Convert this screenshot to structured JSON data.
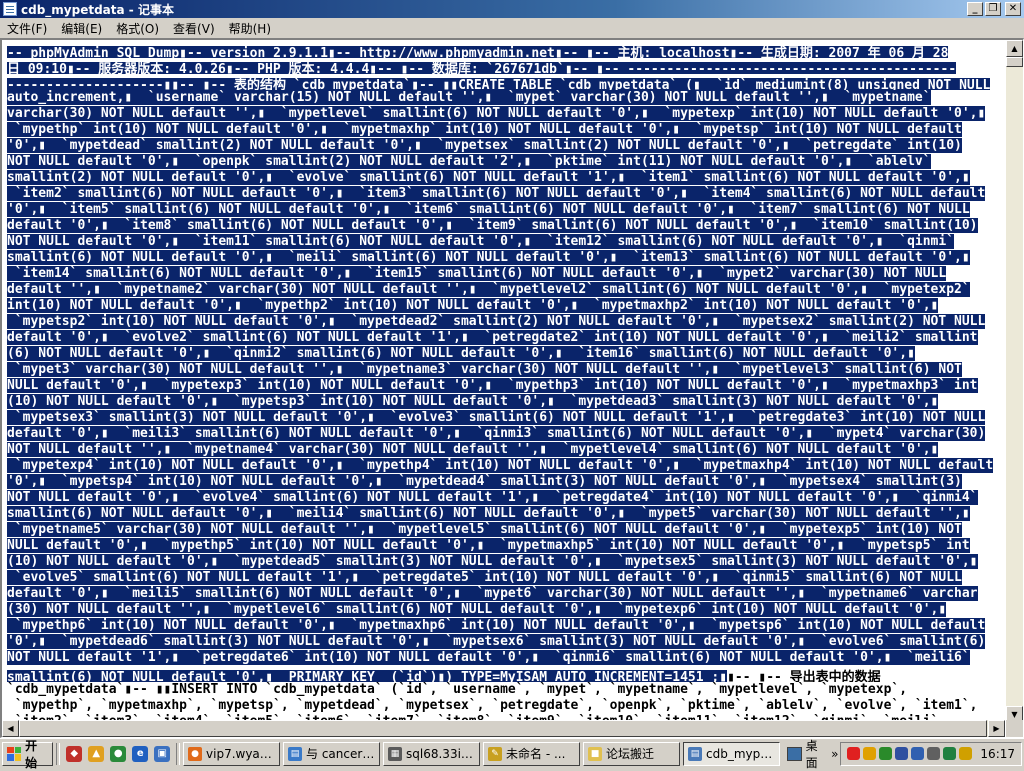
{
  "window": {
    "title": "cdb_mypetdata - 记事本",
    "minimize_glyph": "_",
    "maximize_glyph": "❐",
    "close_glyph": "✕"
  },
  "menu": [
    "文件(F)",
    "编辑(E)",
    "格式(O)",
    "查看(V)",
    "帮助(H)"
  ],
  "editor": {
    "lines": [
      {
        "sel": "-- phpMyAdmin SQL Dump▮-- version 2.9.1.1▮-- http://www.phpmyadmin.net▮-- ▮-- 主机: localhost▮-- 生成日期: 2007 年 06 月 28",
        "rest": ""
      },
      {
        "sel": "日 09:10▮-- 服务器版本: 4.0.26▮-- PHP 版本: 4.4.4▮-- ▮-- 数据库: `267671db`▮-- ▮-- ------------------------------------------",
        "rest": ""
      },
      {
        "sel": "--------------------▮▮-- ▮-- 表的结构 `cdb_mypetdata`▮-- ▮▮CREATE TABLE `cdb_mypetdata` (▮  `id` mediumint(8) unsigned NOT NULL",
        "rest": ""
      },
      {
        "sel": "auto_increment,▮  `username` varchar(15) NOT NULL default '',▮  `mypet` varchar(30) NOT NULL default '',▮  `mypetname`",
        "rest": ""
      },
      {
        "sel": "varchar(30) NOT NULL default '',▮  `mypetlevel` smallint(6) NOT NULL default '0',▮  `mypetexp` int(10) NOT NULL default '0',▮",
        "rest": ""
      },
      {
        "sel": " `mypethp` int(10) NOT NULL default '0',▮  `mypetmaxhp` int(10) NOT NULL default '0',▮  `mypetsp` int(10) NOT NULL default",
        "rest": ""
      },
      {
        "sel": "'0',▮  `mypetdead` smallint(2) NOT NULL default '0',▮  `mypetsex` smallint(2) NOT NULL default '0',▮  `petregdate` int(10)",
        "rest": ""
      },
      {
        "sel": "NOT NULL default '0',▮  `openpk` smallint(2) NOT NULL default '2',▮  `pktime` int(11) NOT NULL default '0',▮  `ablelv`",
        "rest": ""
      },
      {
        "sel": "smallint(2) NOT NULL default '0',▮  `evolve` smallint(6) NOT NULL default '1',▮  `item1` smallint(6) NOT NULL default '0',▮",
        "rest": ""
      },
      {
        "sel": " `item2` smallint(6) NOT NULL default '0',▮  `item3` smallint(6) NOT NULL default '0',▮  `item4` smallint(6) NOT NULL default",
        "rest": ""
      },
      {
        "sel": "'0',▮  `item5` smallint(6) NOT NULL default '0',▮  `item6` smallint(6) NOT NULL default '0',▮  `item7` smallint(6) NOT NULL",
        "rest": ""
      },
      {
        "sel": "default '0',▮  `item8` smallint(6) NOT NULL default '0',▮  `item9` smallint(6) NOT NULL default '0',▮  `item10` smallint(10)",
        "rest": ""
      },
      {
        "sel": "NOT NULL default '0',▮  `item11` smallint(6) NOT NULL default '0',▮  `item12` smallint(6) NOT NULL default '0',▮  `qinmi`",
        "rest": ""
      },
      {
        "sel": "smallint(6) NOT NULL default '0',▮  `meili` smallint(6) NOT NULL default '0',▮  `item13` smallint(6) NOT NULL default '0',▮",
        "rest": ""
      },
      {
        "sel": " `item14` smallint(6) NOT NULL default '0',▮  `item15` smallint(6) NOT NULL default '0',▮  `mypet2` varchar(30) NOT NULL",
        "rest": ""
      },
      {
        "sel": "default '',▮  `mypetname2` varchar(30) NOT NULL default '',▮  `mypetlevel2` smallint(6) NOT NULL default '0',▮  `mypetexp2`",
        "rest": ""
      },
      {
        "sel": "int(10) NOT NULL default '0',▮  `mypethp2` int(10) NOT NULL default '0',▮  `mypetmaxhp2` int(10) NOT NULL default '0',▮",
        "rest": ""
      },
      {
        "sel": " `mypetsp2` int(10) NOT NULL default '0',▮  `mypetdead2` smallint(2) NOT NULL default '0',▮  `mypetsex2` smallint(2) NOT NULL",
        "rest": ""
      },
      {
        "sel": "default '0',▮  `evolve2` smallint(6) NOT NULL default '1',▮  `petregdate2` int(10) NOT NULL default '0',▮  `meili2` smallint",
        "rest": ""
      },
      {
        "sel": "(6) NOT NULL default '0',▮  `qinmi2` smallint(6) NOT NULL default '0',▮  `item16` smallint(6) NOT NULL default '0',▮",
        "rest": ""
      },
      {
        "sel": " `mypet3` varchar(30) NOT NULL default '',▮  `mypetname3` varchar(30) NOT NULL default '',▮  `mypetlevel3` smallint(6) NOT",
        "rest": ""
      },
      {
        "sel": "NULL default '0',▮  `mypetexp3` int(10) NOT NULL default '0',▮  `mypethp3` int(10) NOT NULL default '0',▮  `mypetmaxhp3` int",
        "rest": ""
      },
      {
        "sel": "(10) NOT NULL default '0',▮  `mypetsp3` int(10) NOT NULL default '0',▮  `mypetdead3` smallint(3) NOT NULL default '0',▮",
        "rest": ""
      },
      {
        "sel": " `mypetsex3` smallint(3) NOT NULL default '0',▮  `evolve3` smallint(6) NOT NULL default '1',▮  `petregdate3` int(10) NOT NULL",
        "rest": ""
      },
      {
        "sel": "default '0',▮  `meili3` smallint(6) NOT NULL default '0',▮  `qinmi3` smallint(6) NOT NULL default '0',▮  `mypet4` varchar(30)",
        "rest": ""
      },
      {
        "sel": "NOT NULL default '',▮  `mypetname4` varchar(30) NOT NULL default '',▮  `mypetlevel4` smallint(6) NOT NULL default '0',▮",
        "rest": ""
      },
      {
        "sel": " `mypetexp4` int(10) NOT NULL default '0',▮  `mypethp4` int(10) NOT NULL default '0',▮  `mypetmaxhp4` int(10) NOT NULL default",
        "rest": ""
      },
      {
        "sel": "'0',▮  `mypetsp4` int(10) NOT NULL default '0',▮  `mypetdead4` smallint(3) NOT NULL default '0',▮  `mypetsex4` smallint(3)",
        "rest": ""
      },
      {
        "sel": "NOT NULL default '0',▮  `evolve4` smallint(6) NOT NULL default '1',▮  `petregdate4` int(10) NOT NULL default '0',▮  `qinmi4`",
        "rest": ""
      },
      {
        "sel": "smallint(6) NOT NULL default '0',▮  `meili4` smallint(6) NOT NULL default '0',▮  `mypet5` varchar(30) NOT NULL default '',▮",
        "rest": ""
      },
      {
        "sel": " `mypetname5` varchar(30) NOT NULL default '',▮  `mypetlevel5` smallint(6) NOT NULL default '0',▮  `mypetexp5` int(10) NOT",
        "rest": ""
      },
      {
        "sel": "NULL default '0',▮  `mypethp5` int(10) NOT NULL default '0',▮  `mypetmaxhp5` int(10) NOT NULL default '0',▮  `mypetsp5` int",
        "rest": ""
      },
      {
        "sel": "(10) NOT NULL default '0',▮  `mypetdead5` smallint(3) NOT NULL default '0',▮  `mypetsex5` smallint(3) NOT NULL default '0',▮",
        "rest": ""
      },
      {
        "sel": " `evolve5` smallint(6) NOT NULL default '1',▮  `petregdate5` int(10) NOT NULL default '0',▮  `qinmi5` smallint(6) NOT NULL",
        "rest": ""
      },
      {
        "sel": "default '0',▮  `meili5` smallint(6) NOT NULL default '0',▮  `mypet6` varchar(30) NOT NULL default '',▮  `mypetname6` varchar",
        "rest": ""
      },
      {
        "sel": "(30) NOT NULL default '',▮  `mypetlevel6` smallint(6) NOT NULL default '0',▮  `mypetexp6` int(10) NOT NULL default '0',▮",
        "rest": ""
      },
      {
        "sel": " `mypethp6` int(10) NOT NULL default '0',▮  `mypetmaxhp6` int(10) NOT NULL default '0',▮  `mypetsp6` int(10) NOT NULL default",
        "rest": ""
      },
      {
        "sel": "'0',▮  `mypetdead6` smallint(3) NOT NULL default '0',▮  `mypetsex6` smallint(3) NOT NULL default '0',▮  `evolve6` smallint(6)",
        "rest": ""
      },
      {
        "sel": "NOT NULL default '1',▮  `petregdate6` int(10) NOT NULL default '0',▮  `qinmi6` smallint(6) NOT NULL default '0',▮  `meili6`",
        "rest": ""
      },
      {
        "sel": "smallint(6) NOT NULL default '0',▮  PRIMARY KEY  (`id`)▮) TYPE=MyISAM AUTO_INCREMENT=1451 ;▮",
        "rest": "▮-- ▮-- 导出表中的数据"
      },
      {
        "sel": "",
        "rest": "`cdb_mypetdata`▮-- ▮▮INSERT INTO `cdb_mypetdata` (`id`, `username`, `mypet`, `mypetname`, `mypetlevel`, `mypetexp`,"
      },
      {
        "sel": "",
        "rest": " `mypethp`, `mypetmaxhp`, `mypetsp`, `mypetdead`, `mypetsex`, `petregdate`, `openpk`, `pktime`, `ablelv`, `evolve`, `item1`,"
      },
      {
        "sel": "",
        "rest": " `item2`, `item3`, `item4`, `item5`, `item6`, `item7`, `item8`, `item9`, `item10`, `item11`, `item12`, `qinmi`, `meili`,"
      }
    ],
    "selection_color": "#0a246a"
  },
  "taskbar": {
    "start_label": "开始",
    "quick_launch": [
      {
        "icon": "red-app-icon",
        "color": "#c0302a",
        "glyph": "◆"
      },
      {
        "icon": "warning-icon",
        "color": "#e0a020",
        "glyph": "▲"
      },
      {
        "icon": "browser-icon",
        "color": "#2a8a3a",
        "glyph": "●"
      },
      {
        "icon": "ie-icon",
        "color": "#2060c0",
        "glyph": "e"
      },
      {
        "icon": "window-icon",
        "color": "#3a70c0",
        "glyph": "▣"
      }
    ],
    "tasks": [
      {
        "label": "vip7.wyaj....",
        "icon": "firefox-icon",
        "color": "#e06a1a",
        "glyph": "●",
        "active": false
      },
      {
        "label": "与 cancer ...",
        "icon": "chat-icon",
        "color": "#3a7ac8",
        "glyph": "▤",
        "active": false
      },
      {
        "label": "sql68.33ip....",
        "icon": "document-icon",
        "color": "#5a5a5a",
        "glyph": "▦",
        "active": false
      },
      {
        "label": "未命名 - ...",
        "icon": "paint-icon",
        "color": "#c8a020",
        "glyph": "✎",
        "active": false
      },
      {
        "label": "论坛搬迁",
        "icon": "folder-icon",
        "color": "#e0c050",
        "glyph": "■",
        "active": false
      },
      {
        "label": "cdb_mypet...",
        "icon": "notepad-icon",
        "color": "#4a7ab8",
        "glyph": "▤",
        "active": true
      }
    ],
    "desktop_label": "桌面",
    "tray_icons": [
      {
        "icon": "qq-icon",
        "color": "#e02020"
      },
      {
        "icon": "qq-icon-2",
        "color": "#e0a000"
      },
      {
        "icon": "shield-icon",
        "color": "#2a8a2a"
      },
      {
        "icon": "network-icon",
        "color": "#3050a0"
      },
      {
        "icon": "network-icon-2",
        "color": "#3060b0"
      },
      {
        "icon": "speaker-icon",
        "color": "#606060"
      },
      {
        "icon": "antivirus-icon",
        "color": "#208040"
      },
      {
        "icon": "warning-tray-icon",
        "color": "#d0a000"
      }
    ],
    "clock": "16:17"
  }
}
